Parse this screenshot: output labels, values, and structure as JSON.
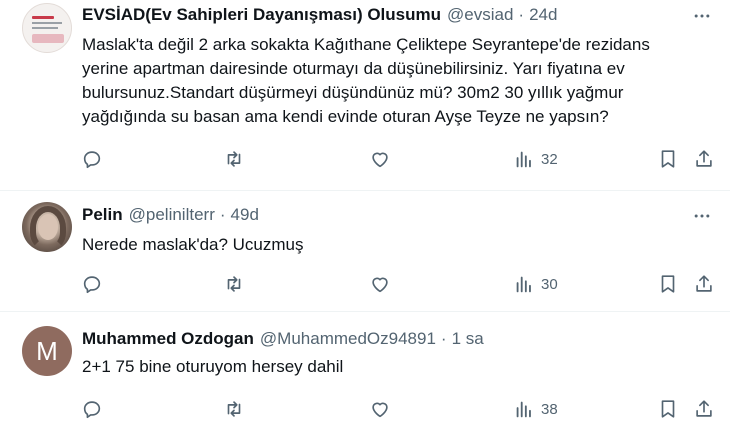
{
  "tweets": [
    {
      "name": "EVSİAD(Ev Sahipleri Dayanışması) Olusumu",
      "handle": "@evsiad",
      "time": "24d",
      "avatar": "org-logo",
      "text_lines": [
        "Maslak'ta değil 2 arka sokakta Kağıthane Çeliktepe Seyrantepe'de rezidans",
        "yerine apartman dairesinde oturmayı da düşünebilirsiniz. Yarı fiyatına ev",
        "bulursunuz.Standart düşürmeyi düşündünüz mü? 30m2 30 yıllık yağmur",
        "yağdığında su basan ama kendi evinde oturan Ayşe Teyze ne yapsın?"
      ],
      "views": "32"
    },
    {
      "name": "Pelin",
      "handle": "@pelinilterr",
      "time": "49d",
      "avatar": "photo",
      "text_lines": [
        "Nerede maslak'da? Ucuzmuş"
      ],
      "views": "30"
    },
    {
      "name": "Muhammed Ozdogan",
      "handle": "@MuhammedOz94891",
      "time": "1 sa",
      "avatar": "M",
      "text_lines": [
        "2+1 75 bine oturuyom hersey dahil"
      ],
      "views": "38"
    }
  ],
  "icons": {
    "more": "more-dots-icon",
    "reply": "reply-icon",
    "retweet": "retweet-icon",
    "like": "like-heart-icon",
    "views": "views-chart-icon",
    "bookmark": "bookmark-icon",
    "share": "share-icon"
  },
  "colors": {
    "text": "#0f1419",
    "muted": "#536471",
    "divider": "#eff3f4",
    "avatar_letter_bg": "#8f6b5f"
  }
}
